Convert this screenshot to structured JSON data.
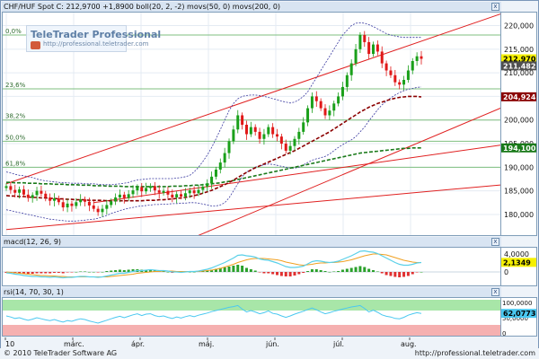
{
  "header": {
    "main": "CHF/HUF Spot C: 212,9700 +1,8900 boll(20, 2, -2) movs(50, 0) movs(200, 0)",
    "macd": "macd(12, 26, 9)",
    "rsi": "rsi(14, 70, 30, 1)",
    "close_button": "x"
  },
  "watermark": {
    "title": "TeleTrader Professional",
    "url": "http://professional.teletrader.com"
  },
  "footer": {
    "copyright": "© 2010 TeleTrader Software AG",
    "url": "http://professional.teletrader.com"
  },
  "colors": {
    "up_candle": "#1aa01a",
    "down_candle": "#e01818",
    "trend": "#e02020",
    "bollinger": "#3a3aa0",
    "ma50": "#8b0000",
    "ma200": "#1a7a1a",
    "macd_line": "#5ad0e8",
    "signal_line": "#f0a020",
    "rsi_line": "#4ac8f0"
  },
  "chart_data": [
    {
      "type": "candlestick",
      "title": "CHF/HUF Spot",
      "x_labels": [
        "10",
        "márc.",
        "ápr.",
        "máj.",
        "jún.",
        "júl.",
        "aug."
      ],
      "y_ticks": [
        "220,000",
        "215,000",
        "210,000",
        "205,000",
        "200,000",
        "195,000",
        "190,000",
        "185,000",
        "180,000"
      ],
      "ylim": [
        176,
        222
      ],
      "fibonacci_levels": [
        {
          "label": "0,0%",
          "value": 218.0
        },
        {
          "label": "23,6%",
          "value": 206.6
        },
        {
          "label": "38,2%",
          "value": 200.0
        },
        {
          "label": "50,0%",
          "value": 195.5
        },
        {
          "label": "61,8%",
          "value": 190.0
        }
      ],
      "value_labels": [
        {
          "text": "212,9700",
          "value": 212.97,
          "color": "#f5f000",
          "fg": "#000000"
        },
        {
          "text": "211,4820",
          "value": 211.48,
          "color": "#505050",
          "fg": "#ffffff"
        },
        {
          "text": "204,9246",
          "value": 204.92,
          "color": "#8b0000",
          "fg": "#ffffff"
        },
        {
          "text": "194,1005",
          "value": 194.1,
          "color": "#1a7a1a",
          "fg": "#ffffff"
        }
      ],
      "close": [
        186.0,
        185.2,
        184.6,
        185.3,
        184.2,
        183.5,
        184.1,
        185.0,
        184.4,
        183.6,
        182.9,
        183.4,
        182.6,
        181.5,
        182.3,
        181.8,
        182.6,
        183.2,
        182.7,
        181.9,
        181.2,
        180.5,
        181.2,
        182.0,
        182.8,
        183.6,
        184.2,
        183.5,
        184.3,
        185.1,
        185.8,
        184.9,
        185.6,
        186.0,
        185.1,
        184.6,
        185.0,
        184.2,
        183.6,
        184.3,
        183.8,
        184.5,
        185.1,
        184.5,
        185.2,
        185.9,
        186.6,
        188.0,
        189.5,
        191.0,
        193.0,
        195.5,
        198.0,
        201.0,
        199.0,
        197.0,
        198.5,
        197.5,
        196.0,
        197.0,
        198.5,
        197.0,
        196.5,
        195.0,
        193.5,
        194.5,
        196.0,
        197.5,
        199.5,
        202.5,
        205.0,
        204.0,
        202.5,
        201.0,
        202.0,
        203.5,
        205.0,
        207.0,
        209.5,
        212.0,
        215.0,
        218.0,
        216.5,
        214.0,
        216.0,
        214.5,
        212.0,
        210.5,
        209.5,
        208.0,
        207.5,
        208.5,
        210.5,
        212.5,
        213.5,
        212.97
      ],
      "bollinger_upper": [
        189,
        188.8,
        188.5,
        188.3,
        188.2,
        188.0,
        187.8,
        187.5,
        187.3,
        187.1,
        187.0,
        186.9,
        186.8,
        186.7,
        186.7,
        186.6,
        186.6,
        186.6,
        186.5,
        186.5,
        186.5,
        186.4,
        186.3,
        186.3,
        186.3,
        186.4,
        186.5,
        186.6,
        186.8,
        187.1,
        187.3,
        187.4,
        187.5,
        187.6,
        187.6,
        187.6,
        187.6,
        187.6,
        187.6,
        187.7,
        187.8,
        188.0,
        188.3,
        189.0,
        190.0,
        191.2,
        192.6,
        194.2,
        196.0,
        198.0,
        200.0,
        202.0,
        203.5,
        204.5,
        205.0,
        205.2,
        205.3,
        205.3,
        205.2,
        205.0,
        204.8,
        204.5,
        204.3,
        204.0,
        203.8,
        203.6,
        203.8,
        204.3,
        205.0,
        206.0,
        207.5,
        209.0,
        210.5,
        212.0,
        213.5,
        215.0,
        216.5,
        218.0,
        219.0,
        220.0,
        220.5,
        220.6,
        220.5,
        220.2,
        219.8,
        219.3,
        218.8,
        218.3,
        218.0,
        217.8,
        217.6,
        217.5,
        217.5,
        217.5,
        217.5,
        217.5
      ],
      "bollinger_lower": [
        181,
        180.8,
        180.6,
        180.4,
        180.2,
        180.0,
        179.8,
        179.6,
        179.4,
        179.2,
        179.0,
        178.9,
        178.8,
        178.7,
        178.6,
        178.6,
        178.6,
        178.7,
        178.8,
        178.9,
        179.0,
        179.2,
        179.5,
        179.8,
        180.2,
        180.5,
        180.8,
        181.1,
        181.3,
        181.5,
        181.7,
        181.8,
        181.9,
        182.0,
        182.1,
        182.1,
        182.2,
        182.2,
        182.3,
        182.3,
        182.4,
        182.4,
        182.5,
        182.5,
        182.4,
        182.2,
        182.0,
        181.8,
        181.8,
        182.0,
        182.5,
        183.5,
        185.0,
        186.5,
        188.0,
        189.0,
        189.5,
        190.0,
        190.3,
        190.5,
        190.7,
        190.6,
        190.4,
        190.2,
        190.0,
        189.8,
        189.8,
        190.0,
        190.5,
        191.0,
        191.5,
        191.8,
        192.0,
        192.3,
        192.8,
        193.5,
        194.2,
        194.8,
        195.3,
        195.8,
        196.5,
        197.5,
        198.5,
        199.8,
        201.0,
        202.2,
        203.2,
        204.0,
        204.7,
        205.3,
        205.8,
        206.2,
        206.5,
        206.7,
        206.9,
        207.0
      ],
      "ma50": [
        184.0,
        183.9,
        183.9,
        183.8,
        183.8,
        183.7,
        183.6,
        183.6,
        183.5,
        183.5,
        183.4,
        183.4,
        183.3,
        183.3,
        183.2,
        183.2,
        183.1,
        183.1,
        183.1,
        183.0,
        183.0,
        183.0,
        183.0,
        182.9,
        182.9,
        182.9,
        182.9,
        182.9,
        182.9,
        182.9,
        182.9,
        182.9,
        183.0,
        183.0,
        183.0,
        183.1,
        183.1,
        183.2,
        183.3,
        183.4,
        183.5,
        183.6,
        183.8,
        184.0,
        184.2,
        184.5,
        184.8,
        185.1,
        185.5,
        185.9,
        186.3,
        186.8,
        187.3,
        187.8,
        188.4,
        188.9,
        189.4,
        189.9,
        190.3,
        190.7,
        191.1,
        191.5,
        191.9,
        192.3,
        192.7,
        193.1,
        193.5,
        194.0,
        194.5,
        195.0,
        195.5,
        196.0,
        196.5,
        197.0,
        197.5,
        198.1,
        198.7,
        199.3,
        199.9,
        200.5,
        201.1,
        201.7,
        202.2,
        202.7,
        203.1,
        203.5,
        203.8,
        204.1,
        204.4,
        204.6,
        204.8,
        204.9,
        205.0,
        205.0,
        205.0,
        204.9
      ],
      "ma200": [
        186.8,
        186.8,
        186.7,
        186.7,
        186.7,
        186.6,
        186.6,
        186.6,
        186.5,
        186.5,
        186.5,
        186.4,
        186.4,
        186.4,
        186.3,
        186.3,
        186.3,
        186.2,
        186.2,
        186.2,
        186.1,
        186.1,
        186.1,
        186.0,
        186.0,
        186.0,
        186.0,
        185.9,
        185.9,
        185.9,
        185.9,
        185.9,
        185.9,
        185.9,
        185.9,
        185.9,
        185.9,
        185.9,
        186.0,
        186.0,
        186.0,
        186.1,
        186.1,
        186.2,
        186.2,
        186.3,
        186.4,
        186.5,
        186.6,
        186.7,
        186.9,
        187.0,
        187.2,
        187.4,
        187.6,
        187.8,
        188.0,
        188.2,
        188.4,
        188.6,
        188.8,
        189.0,
        189.2,
        189.4,
        189.6,
        189.8,
        190.0,
        190.2,
        190.4,
        190.6,
        190.8,
        191.0,
        191.2,
        191.4,
        191.6,
        191.8,
        192.0,
        192.2,
        192.4,
        192.6,
        192.8,
        193.0,
        193.1,
        193.2,
        193.3,
        193.4,
        193.5,
        193.6,
        193.7,
        193.8,
        193.9,
        194.0,
        194.0,
        194.1,
        194.1,
        194.1
      ],
      "trend_lines": [
        {
          "x": [
            0,
            140
          ],
          "y": [
            186.5,
            231
          ]
        },
        {
          "x": [
            40,
            140
          ],
          "y": [
            174,
            213
          ]
        },
        {
          "x": [
            0,
            140
          ],
          "y": [
            176.8,
            188.5
          ]
        },
        {
          "x": [
            20,
            140
          ],
          "y": [
            182.5,
            198.2
          ]
        }
      ]
    },
    {
      "type": "bar",
      "title": "macd(12, 26, 9)",
      "y_ticks": [
        "4,0000",
        "2,0000",
        "0"
      ],
      "ylim": [
        -3,
        5
      ],
      "value_label": {
        "text": "2,1349",
        "value": 2.1349
      },
      "macd_line": [
        -0.2,
        -0.3,
        -0.5,
        -0.6,
        -0.8,
        -0.9,
        -1.0,
        -1.0,
        -1.1,
        -1.1,
        -1.2,
        -1.1,
        -1.2,
        -1.3,
        -1.2,
        -1.2,
        -1.1,
        -1.0,
        -1.0,
        -1.1,
        -1.1,
        -1.2,
        -1.1,
        -0.9,
        -0.7,
        -0.5,
        -0.3,
        -0.3,
        -0.1,
        0.1,
        0.3,
        0.3,
        0.4,
        0.5,
        0.4,
        0.3,
        0.3,
        0.2,
        0.0,
        0.0,
        -0.1,
        0.0,
        0.1,
        0.1,
        0.2,
        0.4,
        0.6,
        0.9,
        1.3,
        1.7,
        2.1,
        2.6,
        3.1,
        3.7,
        3.8,
        3.6,
        3.5,
        3.3,
        2.9,
        2.7,
        2.6,
        2.3,
        2.0,
        1.6,
        1.2,
        1.0,
        1.0,
        1.1,
        1.3,
        1.8,
        2.3,
        2.5,
        2.4,
        2.2,
        2.1,
        2.2,
        2.4,
        2.8,
        3.2,
        3.6,
        4.1,
        4.6,
        4.7,
        4.5,
        4.4,
        4.1,
        3.6,
        3.1,
        2.6,
        2.1,
        1.7,
        1.5,
        1.5,
        1.7,
        2.0,
        2.1
      ],
      "signal_line": [
        0.0,
        -0.1,
        -0.2,
        -0.3,
        -0.4,
        -0.5,
        -0.6,
        -0.7,
        -0.8,
        -0.8,
        -0.9,
        -0.9,
        -1.0,
        -1.0,
        -1.1,
        -1.1,
        -1.1,
        -1.1,
        -1.1,
        -1.1,
        -1.1,
        -1.1,
        -1.1,
        -1.1,
        -1.0,
        -0.9,
        -0.8,
        -0.7,
        -0.6,
        -0.5,
        -0.3,
        -0.2,
        -0.1,
        0.0,
        0.1,
        0.1,
        0.2,
        0.2,
        0.2,
        0.1,
        0.1,
        0.1,
        0.1,
        0.1,
        0.1,
        0.2,
        0.3,
        0.4,
        0.6,
        0.8,
        1.1,
        1.4,
        1.7,
        2.1,
        2.4,
        2.7,
        2.9,
        3.0,
        3.0,
        3.0,
        2.9,
        2.8,
        2.7,
        2.5,
        2.2,
        2.0,
        1.8,
        1.6,
        1.5,
        1.6,
        1.7,
        1.9,
        2.0,
        2.0,
        2.1,
        2.1,
        2.2,
        2.3,
        2.5,
        2.7,
        3.0,
        3.3,
        3.6,
        3.8,
        4.0,
        4.0,
        3.9,
        3.8,
        3.5,
        3.2,
        2.9,
        2.6,
        2.4,
        2.2,
        2.1,
        2.1
      ]
    },
    {
      "type": "line",
      "title": "rsi(14, 70, 30, 1)",
      "y_ticks": [
        "100,0000",
        "50,0000",
        "0"
      ],
      "ylim": [
        0,
        100
      ],
      "value_label": {
        "text": "62,0773",
        "value": 62.0773
      },
      "overbought": 70,
      "oversold": 30,
      "rsi": [
        55,
        52,
        48,
        50,
        46,
        43,
        46,
        50,
        47,
        44,
        42,
        45,
        41,
        38,
        42,
        40,
        44,
        47,
        45,
        41,
        38,
        35,
        39,
        43,
        47,
        51,
        54,
        50,
        54,
        58,
        61,
        56,
        60,
        61,
        56,
        53,
        55,
        51,
        48,
        52,
        49,
        53,
        56,
        53,
        57,
        60,
        63,
        67,
        70,
        73,
        76,
        79,
        81,
        84,
        74,
        66,
        70,
        66,
        61,
        64,
        69,
        62,
        60,
        55,
        51,
        55,
        60,
        64,
        68,
        73,
        77,
        72,
        66,
        61,
        64,
        68,
        71,
        74,
        77,
        80,
        82,
        84,
        76,
        66,
        71,
        65,
        58,
        54,
        52,
        48,
        47,
        51,
        57,
        61,
        64,
        62
      ]
    }
  ],
  "month_labels": [
    "10",
    "márc.",
    "ápr.",
    "máj.",
    "jún.",
    "júl.",
    "aug."
  ]
}
